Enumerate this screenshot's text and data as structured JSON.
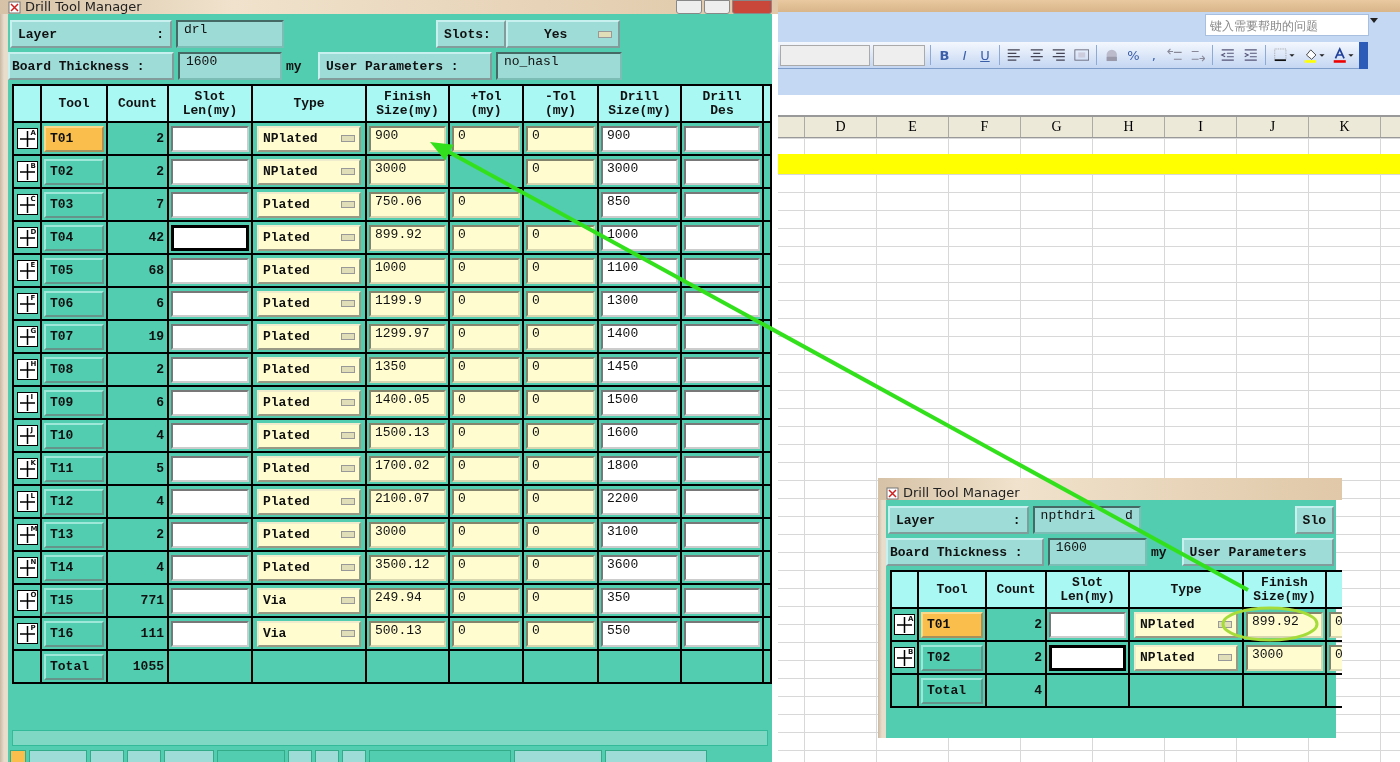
{
  "excel": {
    "help_placeholder": "键入需要帮助的问题",
    "toolbar": [
      {
        "kind": "combo"
      },
      {
        "kind": "combo"
      },
      {
        "kind": "sep"
      },
      {
        "kind": "bold",
        "text": "B"
      },
      {
        "kind": "italic",
        "text": "I"
      },
      {
        "kind": "underline",
        "text": "U"
      },
      {
        "kind": "sep"
      },
      {
        "kind": "align-left"
      },
      {
        "kind": "align-center"
      },
      {
        "kind": "align-right"
      },
      {
        "kind": "merge"
      },
      {
        "kind": "sep"
      },
      {
        "kind": "currency"
      },
      {
        "kind": "symbol",
        "text": "%"
      },
      {
        "kind": "symbol",
        "text": ","
      },
      {
        "kind": "inc-decimal"
      },
      {
        "kind": "dec-decimal"
      },
      {
        "kind": "sep"
      },
      {
        "kind": "outdent"
      },
      {
        "kind": "indent"
      },
      {
        "kind": "sep"
      },
      {
        "kind": "borders"
      },
      {
        "kind": "fill"
      },
      {
        "kind": "font-color"
      }
    ],
    "columns": [
      "D",
      "E",
      "F",
      "G",
      "H",
      "I",
      "J",
      "K"
    ]
  },
  "windows": [
    {
      "title": "Drill Tool Manager",
      "layer_label": "Layer",
      "colon": ":",
      "layer": "drl",
      "slots_label": "Slots:",
      "slots": "Yes",
      "thickness_label": "Board Thickness :",
      "thickness": "1600",
      "unit": "my",
      "user_params_label": "User Parameters :",
      "user_params": "no_hasl",
      "headers": [
        "Tool",
        "Count",
        "Slot\nLen(my)",
        "Type",
        "Finish\nSize(my)",
        "+Tol\n(my)",
        "-Tol\n(my)",
        "Drill\nSize(my)",
        "Drill\nDes"
      ],
      "rows": [
        {
          "mark": "A",
          "tool": "T01",
          "selected": true,
          "count": "2",
          "slot_focused": false,
          "type": "NPlated",
          "finish": "900",
          "plus_tol": "0",
          "minus_tol": "0",
          "drill_size": "900"
        },
        {
          "mark": "B",
          "tool": "T02",
          "selected": false,
          "count": "2",
          "slot_focused": false,
          "type": "NPlated",
          "finish": "3000",
          "minus_tol": "0",
          "drill_size": "3000"
        },
        {
          "mark": "C",
          "tool": "T03",
          "selected": false,
          "count": "7",
          "slot_focused": false,
          "type": "Plated",
          "finish": "750.06",
          "plus_tol": "0",
          "drill_size": "850"
        },
        {
          "mark": "D",
          "tool": "T04",
          "selected": false,
          "count": "42",
          "slot_focused": true,
          "type": "Plated",
          "finish": "899.92",
          "plus_tol": "0",
          "minus_tol": "0",
          "drill_size": "1000"
        },
        {
          "mark": "E",
          "tool": "T05",
          "selected": false,
          "count": "68",
          "slot_focused": false,
          "type": "Plated",
          "finish": "1000",
          "plus_tol": "0",
          "minus_tol": "0",
          "drill_size": "1100"
        },
        {
          "mark": "F",
          "tool": "T06",
          "selected": false,
          "count": "6",
          "slot_focused": false,
          "type": "Plated",
          "finish": "1199.9",
          "plus_tol": "0",
          "minus_tol": "0",
          "drill_size": "1300"
        },
        {
          "mark": "G",
          "tool": "T07",
          "selected": false,
          "count": "19",
          "slot_focused": false,
          "type": "Plated",
          "finish": "1299.97",
          "plus_tol": "0",
          "minus_tol": "0",
          "drill_size": "1400"
        },
        {
          "mark": "H",
          "tool": "T08",
          "selected": false,
          "count": "2",
          "slot_focused": false,
          "type": "Plated",
          "finish": "1350",
          "plus_tol": "0",
          "minus_tol": "0",
          "drill_size": "1450"
        },
        {
          "mark": "I",
          "tool": "T09",
          "selected": false,
          "count": "6",
          "slot_focused": false,
          "type": "Plated",
          "finish": "1400.05",
          "plus_tol": "0",
          "minus_tol": "0",
          "drill_size": "1500"
        },
        {
          "mark": "J",
          "tool": "T10",
          "selected": false,
          "count": "4",
          "slot_focused": false,
          "type": "Plated",
          "finish": "1500.13",
          "plus_tol": "0",
          "minus_tol": "0",
          "drill_size": "1600"
        },
        {
          "mark": "K",
          "tool": "T11",
          "selected": false,
          "count": "5",
          "slot_focused": false,
          "type": "Plated",
          "finish": "1700.02",
          "plus_tol": "0",
          "minus_tol": "0",
          "drill_size": "1800"
        },
        {
          "mark": "L",
          "tool": "T12",
          "selected": false,
          "count": "4",
          "slot_focused": false,
          "type": "Plated",
          "finish": "2100.07",
          "plus_tol": "0",
          "minus_tol": "0",
          "drill_size": "2200"
        },
        {
          "mark": "M",
          "tool": "T13",
          "selected": false,
          "count": "2",
          "slot_focused": false,
          "type": "Plated",
          "finish": "3000",
          "plus_tol": "0",
          "minus_tol": "0",
          "drill_size": "3100"
        },
        {
          "mark": "N",
          "tool": "T14",
          "selected": false,
          "count": "4",
          "slot_focused": false,
          "type": "Plated",
          "finish": "3500.12",
          "plus_tol": "0",
          "minus_tol": "0",
          "drill_size": "3600"
        },
        {
          "mark": "O",
          "tool": "T15",
          "selected": false,
          "count": "771",
          "slot_focused": false,
          "type": "Via",
          "finish": "249.94",
          "plus_tol": "0",
          "minus_tol": "0",
          "drill_size": "350"
        },
        {
          "mark": "P",
          "tool": "T16",
          "selected": false,
          "count": "111",
          "slot_focused": false,
          "type": "Via",
          "finish": "500.13",
          "plus_tol": "0",
          "minus_tol": "0",
          "drill_size": "550"
        }
      ],
      "total_label": "Total",
      "total": "1055"
    },
    {
      "title": "Drill Tool Manager",
      "layer_label": "Layer",
      "colon": ":",
      "layer": "npthdri d",
      "slots_label": "Slo",
      "thickness_label": "Board Thickness :",
      "thickness": "1600",
      "unit": "my",
      "user_params_label": "User Parameters",
      "headers": [
        "Tool",
        "Count",
        "Slot\nLen(my)",
        "Type",
        "Finish\nSize(my)"
      ],
      "rows": [
        {
          "mark": "A",
          "tool": "T01",
          "selected": true,
          "count": "2",
          "slot_focused": false,
          "type": "NPlated",
          "finish": "899.92",
          "plus_tol": "0"
        },
        {
          "mark": "B",
          "tool": "T02",
          "selected": false,
          "count": "2",
          "slot_focused": true,
          "type": "NPlated",
          "finish": "3000",
          "plus_tol": "0"
        }
      ],
      "total_label": "Total",
      "total": "4"
    }
  ]
}
